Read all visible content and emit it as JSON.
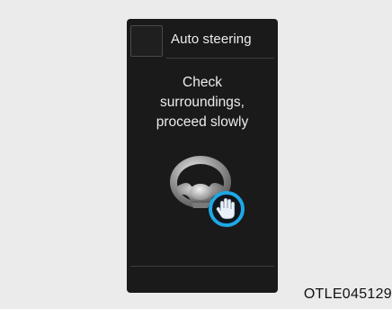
{
  "display": {
    "mode_title": "Auto steering",
    "message_lines": [
      "Check",
      "surroundings,",
      "proceed slowly"
    ],
    "icons": {
      "mode_icon": "blank-icon-slot",
      "main_icon": "steering-wheel-icon",
      "badge_icon": "hands-on-icon"
    }
  },
  "caption": "OTLE045129",
  "colors": {
    "screen_background": "#1a1a1a",
    "text": "#ececec",
    "badge_accent": "#1ea8e6",
    "page_background": "#ebebeb"
  }
}
